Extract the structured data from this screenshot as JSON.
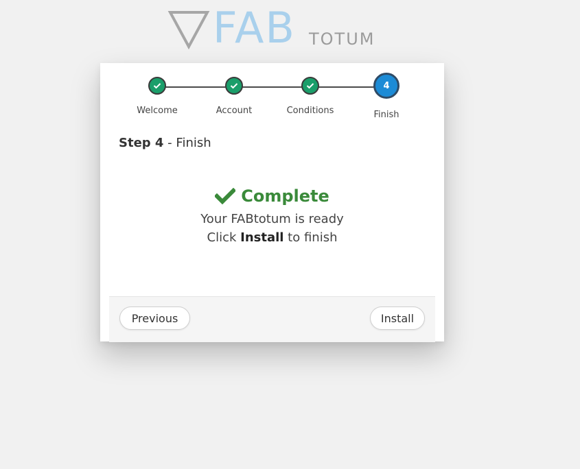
{
  "logo": {
    "brand_main": "FAB",
    "brand_sub": "TOTUM"
  },
  "stepper": {
    "steps": [
      {
        "label": "Welcome",
        "state": "done"
      },
      {
        "label": "Account",
        "state": "done"
      },
      {
        "label": "Conditions",
        "state": "done"
      },
      {
        "label": "Finish",
        "state": "active",
        "number": "4"
      }
    ]
  },
  "heading": {
    "step_label": "Step 4",
    "separator": " - ",
    "step_name": "Finish"
  },
  "message": {
    "title": "Complete",
    "line1": "Your FABtotum is ready",
    "line2_prefix": "Click ",
    "line2_bold": "Install",
    "line2_suffix": " to finish"
  },
  "footer": {
    "previous_label": "Previous",
    "install_label": "Install"
  },
  "colors": {
    "done_step": "#1a9e6a",
    "active_step": "#1c8bd6",
    "success_text": "#3a8a3a",
    "logo_blue": "#a9d0ec",
    "logo_gray": "#9b9b9b"
  }
}
